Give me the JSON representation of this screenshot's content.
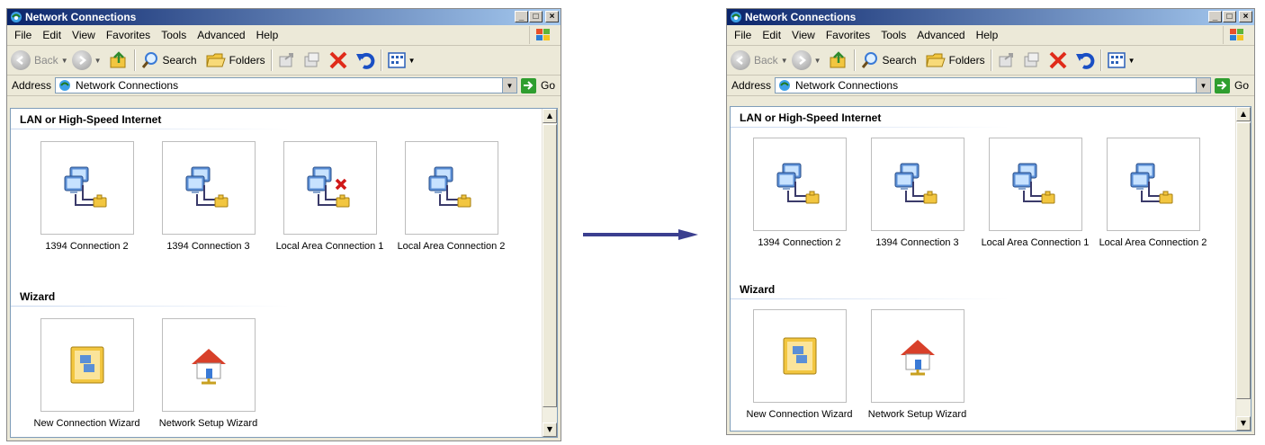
{
  "before": {
    "window_title": "Network Connections",
    "menu": [
      "File",
      "Edit",
      "View",
      "Favorites",
      "Tools",
      "Advanced",
      "Help"
    ],
    "toolbar": {
      "back": "Back",
      "search": "Search",
      "folders": "Folders"
    },
    "address": {
      "label": "Address",
      "value": "Network Connections",
      "go": "Go"
    },
    "groups": [
      {
        "title": "LAN or High-Speed Internet",
        "items": [
          {
            "label": "1394 Connection 2",
            "icon": "network-connection-icon"
          },
          {
            "label": "1394 Connection 3",
            "icon": "network-connection-icon"
          },
          {
            "label": "Local Area Connection 1",
            "icon": "network-connection-disconnected-icon"
          },
          {
            "label": "Local Area Connection 2",
            "icon": "network-connection-icon"
          }
        ]
      },
      {
        "title": "Wizard",
        "items": [
          {
            "label": "New Connection Wizard",
            "icon": "new-connection-wizard-icon"
          },
          {
            "label": "Network Setup Wizard",
            "icon": "network-setup-wizard-icon"
          }
        ]
      }
    ]
  },
  "after": {
    "window_title": "Network Connections",
    "menu": [
      "File",
      "Edit",
      "View",
      "Favorites",
      "Tools",
      "Advanced",
      "Help"
    ],
    "toolbar": {
      "back": "Back",
      "search": "Search",
      "folders": "Folders"
    },
    "address": {
      "label": "Address",
      "value": "Network Connections",
      "go": "Go"
    },
    "groups": [
      {
        "title": "LAN or High-Speed Internet",
        "items": [
          {
            "label": "1394 Connection 2",
            "icon": "network-connection-icon"
          },
          {
            "label": "1394 Connection 3",
            "icon": "network-connection-icon"
          },
          {
            "label": "Local Area Connection 1",
            "icon": "network-connection-icon"
          },
          {
            "label": "Local Area Connection 2",
            "icon": "network-connection-icon"
          }
        ]
      },
      {
        "title": "Wizard",
        "items": [
          {
            "label": "New Connection Wizard",
            "icon": "new-connection-wizard-icon"
          },
          {
            "label": "Network Setup Wizard",
            "icon": "network-setup-wizard-icon"
          }
        ]
      }
    ]
  },
  "colors": {
    "title_gradient_start": "#0a246a",
    "title_gradient_end": "#a6caf0",
    "window_bg": "#ece9d8",
    "arrow": "#3b3f8f",
    "disconnected_x": "#d01818",
    "go_green": "#2f9e2f"
  }
}
